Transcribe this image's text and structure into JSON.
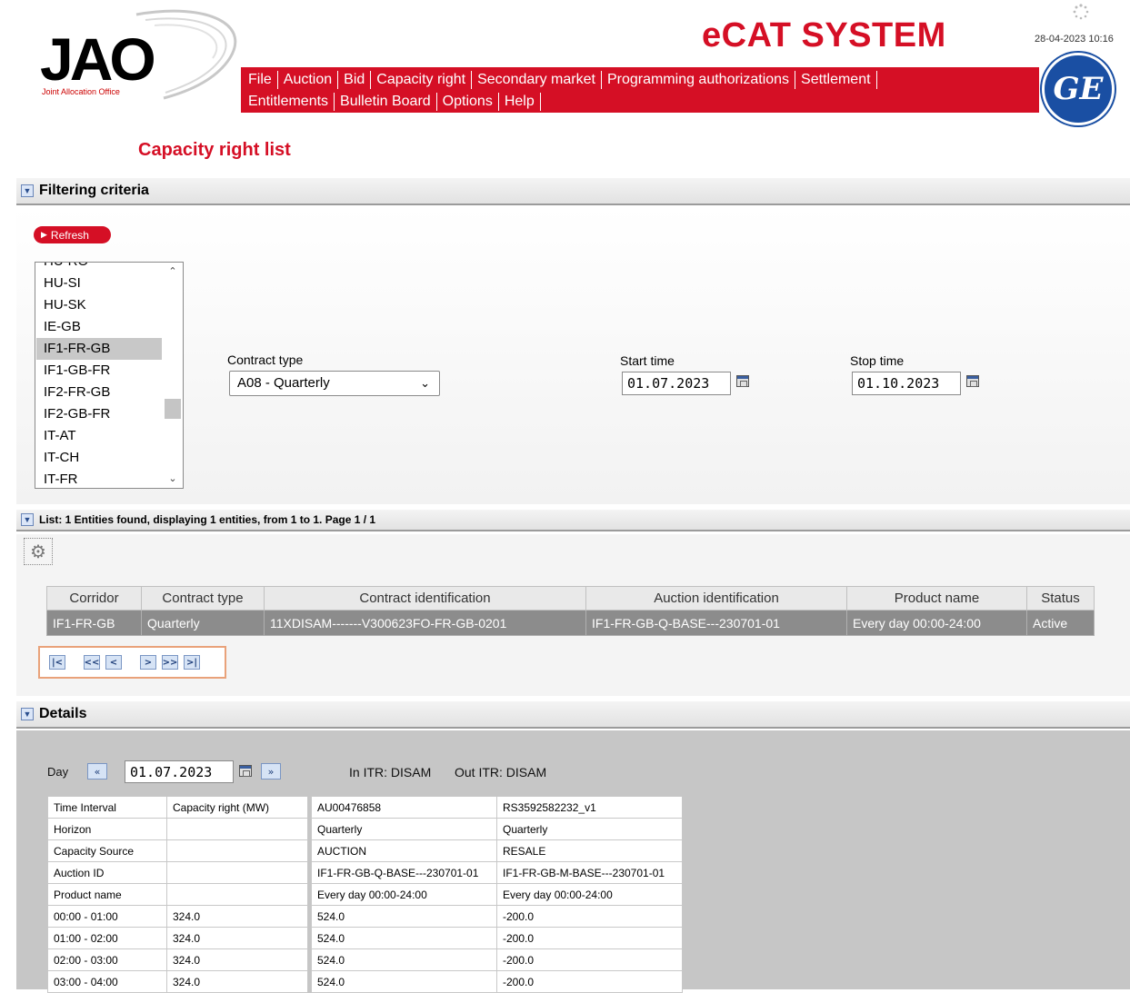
{
  "header": {
    "logo_text": "JAO",
    "logo_subtext": "Joint Allocation Office",
    "app_title": "eCAT SYSTEM",
    "datetime": "28-04-2023 10:16",
    "ge_logo": "GE"
  },
  "menu": {
    "row1": [
      "File",
      "Auction",
      "Bid",
      "Capacity right",
      "Secondary market",
      "Programming authorizations",
      "Settlement"
    ],
    "row2": [
      "Entitlements",
      "Bulletin Board",
      "Options",
      "Help"
    ]
  },
  "page_title": "Capacity right list",
  "filter": {
    "section_title": "Filtering criteria",
    "refresh_label": "Refresh",
    "corridor_options": [
      "HU-RO",
      "HU-SI",
      "HU-SK",
      "IE-GB",
      "IF1-FR-GB",
      "IF1-GB-FR",
      "IF2-FR-GB",
      "IF2-GB-FR",
      "IT-AT",
      "IT-CH",
      "IT-FR"
    ],
    "selected_corridor": "IF1-FR-GB",
    "contract_type_label": "Contract type",
    "contract_type_value": "A08 - Quarterly",
    "start_time_label": "Start time",
    "start_time_value": "01.07.2023",
    "stop_time_label": "Stop time",
    "stop_time_value": "01.10.2023"
  },
  "list": {
    "section_title": "List: 1 Entities found, displaying 1 entities, from 1 to 1. Page 1 / 1",
    "columns": [
      "Corridor",
      "Contract type",
      "Contract identification",
      "Auction identification",
      "Product name",
      "Status"
    ],
    "rows": [
      [
        "IF1-FR-GB",
        "Quarterly",
        "11XDISAM-------V300623FO-FR-GB-0201",
        "IF1-FR-GB-Q-BASE---230701-01",
        "Every day 00:00-24:00",
        "Active"
      ]
    ],
    "pager": [
      "|<",
      "<<",
      "<",
      ">",
      ">>",
      ">|"
    ]
  },
  "details": {
    "section_title": "Details",
    "day_label": "Day",
    "day_value": "01.07.2023",
    "in_itr": "In ITR: DISAM",
    "out_itr": "Out ITR: DISAM",
    "rows": [
      [
        "Time Interval",
        "Capacity right (MW)",
        "AU00476858",
        "RS3592582232_v1"
      ],
      [
        "Horizon",
        "",
        "Quarterly",
        "Quarterly"
      ],
      [
        "Capacity Source",
        "",
        "AUCTION",
        "RESALE"
      ],
      [
        "Auction ID",
        "",
        "IF1-FR-GB-Q-BASE---230701-01",
        "IF1-FR-GB-M-BASE---230701-01"
      ],
      [
        "Product name",
        "",
        "Every day 00:00-24:00",
        "Every day 00:00-24:00"
      ],
      [
        "00:00 - 01:00",
        "324.0",
        "524.0",
        "-200.0"
      ],
      [
        "01:00 - 02:00",
        "324.0",
        "524.0",
        "-200.0"
      ],
      [
        "02:00 - 03:00",
        "324.0",
        "524.0",
        "-200.0"
      ],
      [
        "03:00 - 04:00",
        "324.0",
        "524.0",
        "-200.0"
      ]
    ]
  },
  "colors": {
    "brand_red": "#d50f25",
    "ge_blue": "#1a4fa3"
  }
}
